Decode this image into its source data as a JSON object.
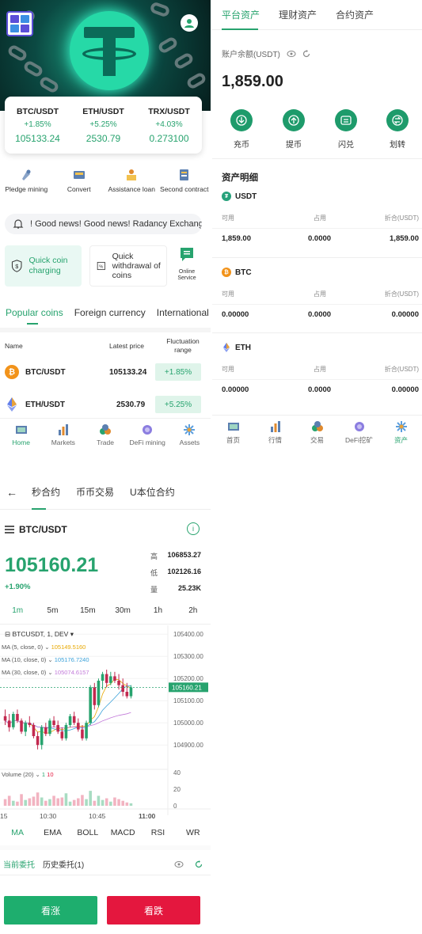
{
  "colors": {
    "accent": "#27a36e",
    "up": "#27a36e",
    "down": "#e4173e",
    "buy": "#1eae6e",
    "sell": "#e4173e"
  },
  "home": {
    "tickers": [
      {
        "pair": "BTC/USDT",
        "change": "+1.85%",
        "price": "105133.24"
      },
      {
        "pair": "ETH/USDT",
        "change": "+5.25%",
        "price": "2530.79"
      },
      {
        "pair": "TRX/USDT",
        "change": "+4.03%",
        "price": "0.273100"
      }
    ],
    "menu": [
      {
        "label": "Pledge mining",
        "icon": "pledge-icon"
      },
      {
        "label": "Convert",
        "icon": "convert-icon"
      },
      {
        "label": "Assistance loan",
        "icon": "loan-icon"
      },
      {
        "label": "Second contract",
        "icon": "contract-icon"
      }
    ],
    "notice": "! Good news! Good news! Radancy Exchange",
    "quick_charge": "Quick coin charging",
    "quick_withdraw": "Quick withdrawal of coins",
    "online_service": "Online Service",
    "coin_tabs": [
      "Popular coins",
      "Foreign currency",
      "International"
    ],
    "table_headers": {
      "name": "Name",
      "price": "Latest price",
      "range": "Fluctuation range"
    },
    "rows": [
      {
        "pair": "BTC/USDT",
        "price": "105133.24",
        "change": "+1.85%"
      },
      {
        "pair": "ETH/USDT",
        "price": "2530.79",
        "change": "+5.25%"
      }
    ],
    "nav": [
      "Home",
      "Markets",
      "Trade",
      "DeFi mining",
      "Assets"
    ]
  },
  "assets": {
    "tabs": [
      "平台资产",
      "理财资产",
      "合约资产"
    ],
    "balance_label": "账户余额(USDT)",
    "balance": "1,859.00",
    "actions": [
      "充币",
      "提币",
      "闪兑",
      "划转"
    ],
    "detail_title": "资产明细",
    "col_labels": [
      "可用",
      "占用",
      "折合(USDT)"
    ],
    "coins": [
      {
        "name": "USDT",
        "available": "1,859.00",
        "occupied": "0.0000",
        "equiv": "1,859.00"
      },
      {
        "name": "BTC",
        "available": "0.00000",
        "occupied": "0.0000",
        "equiv": "0.00000"
      },
      {
        "name": "ETH",
        "available": "0.00000",
        "occupied": "0.0000",
        "equiv": "0.00000"
      }
    ],
    "nav": [
      "首页",
      "行情",
      "交易",
      "DeFi挖矿",
      "资产"
    ]
  },
  "trade": {
    "tabs": [
      "秒合约",
      "币币交易",
      "U本位合约"
    ],
    "pair": "BTC/USDT",
    "price": "105160.21",
    "change": "+1.90%",
    "high_label": "高",
    "high": "106853.27",
    "low_label": "低",
    "low": "102126.16",
    "vol_label": "量",
    "vol": "25.23K",
    "timeframes": [
      "1m",
      "5m",
      "15m",
      "30m",
      "1h",
      "2h"
    ],
    "chart_title": "BTCUSDT, 1, DEV",
    "ma5": "MA (5, close, 0)",
    "ma5_val": "105149.5160",
    "ma10": "MA (10, close, 0)",
    "ma10_val": "105176.7240",
    "ma30": "MA (30, close, 0)",
    "ma30_val": "105074.6157",
    "volume_label": "Volume (20)",
    "vol_a": "1",
    "vol_b": "10",
    "indicators": [
      "MA",
      "EMA",
      "BOLL",
      "MACD",
      "RSI",
      "WR"
    ],
    "order_tabs": [
      "当前委托",
      "历史委托(1)"
    ],
    "buy": "看涨",
    "sell": "看跌"
  },
  "chart_data": {
    "type": "candlestick",
    "title": "BTCUSDT, 1, DEV",
    "x_ticks": [
      "15",
      "10:30",
      "10:45",
      "11:00"
    ],
    "y_ticks": [
      105400.0,
      105300.0,
      105200.0,
      105100.0,
      105000.0,
      104900.0
    ],
    "last_price": 105160.21,
    "ylim": [
      104840,
      105440
    ],
    "volume_ticks": [
      40,
      20,
      0
    ],
    "candles": [
      [
        105030,
        105060,
        104990,
        105010
      ],
      [
        105010,
        105040,
        104960,
        104980
      ],
      [
        104980,
        105050,
        104970,
        105040
      ],
      [
        105040,
        105060,
        105000,
        105010
      ],
      [
        105010,
        105020,
        104950,
        104960
      ],
      [
        104960,
        105010,
        104940,
        105000
      ],
      [
        105000,
        105030,
        104980,
        104990
      ],
      [
        104990,
        105000,
        104930,
        104940
      ],
      [
        104940,
        104960,
        104880,
        104900
      ],
      [
        104900,
        104990,
        104880,
        104980
      ],
      [
        104980,
        105000,
        104940,
        104950
      ],
      [
        104950,
        105020,
        104940,
        105010
      ],
      [
        105010,
        105030,
        104980,
        104990
      ],
      [
        104990,
        105010,
        104950,
        104960
      ],
      [
        104960,
        104980,
        104920,
        104930
      ],
      [
        104930,
        105000,
        104920,
        104990
      ],
      [
        104990,
        105040,
        104980,
        105030
      ],
      [
        105030,
        105050,
        104990,
        105000
      ],
      [
        105000,
        105020,
        104960,
        104970
      ],
      [
        104970,
        104990,
        104920,
        104930
      ],
      [
        104930,
        105010,
        104920,
        105000
      ],
      [
        105000,
        105170,
        104990,
        105160
      ],
      [
        105160,
        105180,
        105060,
        105080
      ],
      [
        105080,
        105200,
        105070,
        105190
      ],
      [
        105190,
        105230,
        105150,
        105220
      ],
      [
        105220,
        105240,
        105160,
        105180
      ],
      [
        105180,
        105230,
        105170,
        105210
      ],
      [
        105210,
        105230,
        105180,
        105190
      ],
      [
        105190,
        105220,
        105150,
        105170
      ],
      [
        105170,
        105200,
        105120,
        105140
      ],
      [
        105140,
        105180,
        105110,
        105120
      ],
      [
        105120,
        105170,
        105110,
        105160
      ]
    ],
    "volumes": [
      8,
      12,
      6,
      5,
      14,
      7,
      9,
      11,
      16,
      10,
      6,
      8,
      12,
      9,
      10,
      15,
      5,
      7,
      9,
      13,
      8,
      18,
      6,
      12,
      7,
      9,
      5,
      10,
      8,
      6,
      4,
      3
    ],
    "ma_series": [
      {
        "name": "MA (5, close, 0)",
        "color": "#e8a800"
      },
      {
        "name": "MA (10, close, 0)",
        "color": "#3aa1d9"
      },
      {
        "name": "MA (30, close, 0)",
        "color": "#c27ad9"
      }
    ]
  }
}
